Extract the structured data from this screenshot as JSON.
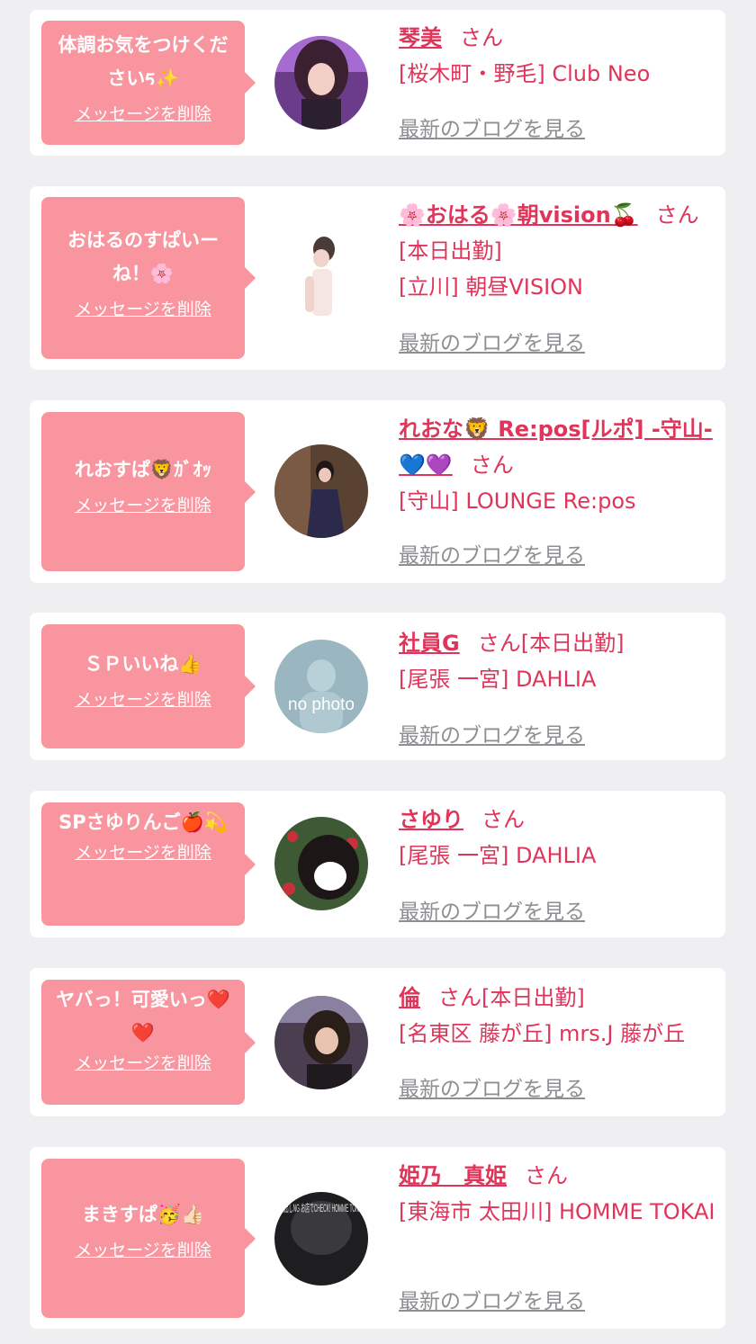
{
  "accent_color": "#e0355a",
  "bubble_color": "#f8959f",
  "link_gray": "#8e8e93",
  "delete_label": "メッセージを削除",
  "blog_label": "最新のブログを見る",
  "san_label": "さん",
  "items": [
    {
      "message": "体調お気をつけくださいᰁ✨",
      "name": "琴美",
      "extra": "",
      "shop": "[桜木町・野毛] Club Neo"
    },
    {
      "message": "おはるのすぱいーね！🌸",
      "name": "🌸おはる🌸朝vision🍒",
      "extra": "[本日出勤]",
      "shop": "[立川] 朝昼VISION"
    },
    {
      "message": "れおすぱ🦁ｶﾞｵｯ",
      "name": "れおな🦁 Re:pos[ルポ] -守山-💙💜",
      "extra": "",
      "shop": "[守山] LOUNGE Re:pos"
    },
    {
      "message": "ＳＰいいね👍",
      "name": "社員G",
      "extra": "[本日出勤]",
      "shop": "[尾張 一宮] DAHLIA",
      "avatar_text": "no photo"
    },
    {
      "message": "SPさゆりんご🍎💫",
      "name": "さゆり",
      "extra": "",
      "shop": "[尾張 一宮] DAHLIA"
    },
    {
      "message": "ヤバっ！可愛いっ❤️❤️",
      "name": "倫",
      "extra": "[本日出勤]",
      "shop": "[名東区 藤が丘] mrs.J 藤が丘"
    },
    {
      "message": "まきすぱ🥳👍🏻",
      "name": "姫乃　真姫",
      "extra": "",
      "shop": "[東海市 太田川] HOMME TOKAI",
      "avatar_text": "顔出しNG お店でCHECK! HOMME TOKAI"
    }
  ]
}
